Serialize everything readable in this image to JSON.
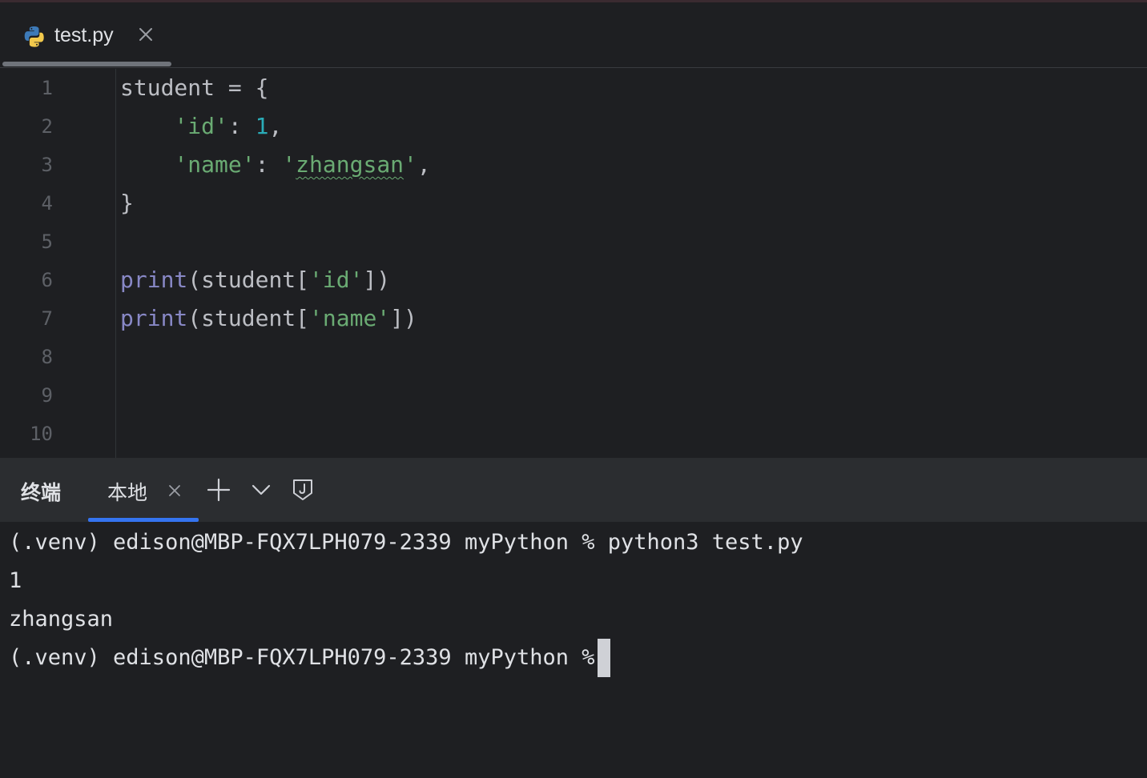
{
  "tab": {
    "filename": "test.py",
    "icon": "python-icon",
    "close_icon": "close-icon"
  },
  "editor": {
    "line_numbers": [
      "1",
      "2",
      "3",
      "4",
      "5",
      "6",
      "7",
      "8",
      "9",
      "10"
    ],
    "lines": [
      [
        {
          "t": "student = {",
          "c": "plain"
        }
      ],
      [
        {
          "t": "    ",
          "c": "plain"
        },
        {
          "t": "'id'",
          "c": "str"
        },
        {
          "t": ": ",
          "c": "plain"
        },
        {
          "t": "1",
          "c": "num"
        },
        {
          "t": ",",
          "c": "plain"
        }
      ],
      [
        {
          "t": "    ",
          "c": "plain"
        },
        {
          "t": "'name'",
          "c": "str"
        },
        {
          "t": ": ",
          "c": "plain"
        },
        {
          "t": "'",
          "c": "str"
        },
        {
          "t": "zhangsan",
          "c": "str-typo"
        },
        {
          "t": "'",
          "c": "str"
        },
        {
          "t": ",",
          "c": "plain"
        }
      ],
      [
        {
          "t": "}",
          "c": "plain"
        }
      ],
      [],
      [
        {
          "t": "print",
          "c": "fn"
        },
        {
          "t": "(student[",
          "c": "plain"
        },
        {
          "t": "'id'",
          "c": "str"
        },
        {
          "t": "])",
          "c": "plain"
        }
      ],
      [
        {
          "t": "print",
          "c": "fn"
        },
        {
          "t": "(student[",
          "c": "plain"
        },
        {
          "t": "'name'",
          "c": "str"
        },
        {
          "t": "])",
          "c": "plain"
        }
      ],
      [],
      [],
      []
    ],
    "colors": {
      "plain": "#bcbec4",
      "str": "#6aab73",
      "num": "#2aacb8",
      "fn": "#8888c6"
    }
  },
  "terminal_panel": {
    "title": "终端",
    "tab_label": "本地",
    "icons": [
      "close-icon",
      "plus-icon",
      "chevron-down-icon",
      "shield-icon"
    ],
    "accent": "#3574f0"
  },
  "terminal": {
    "lines": [
      "(.venv) edison@MBP-FQX7LPH079-2339 myPython % python3 test.py",
      "1",
      "zhangsan",
      "(.venv) edison@MBP-FQX7LPH079-2339 myPython % "
    ]
  }
}
